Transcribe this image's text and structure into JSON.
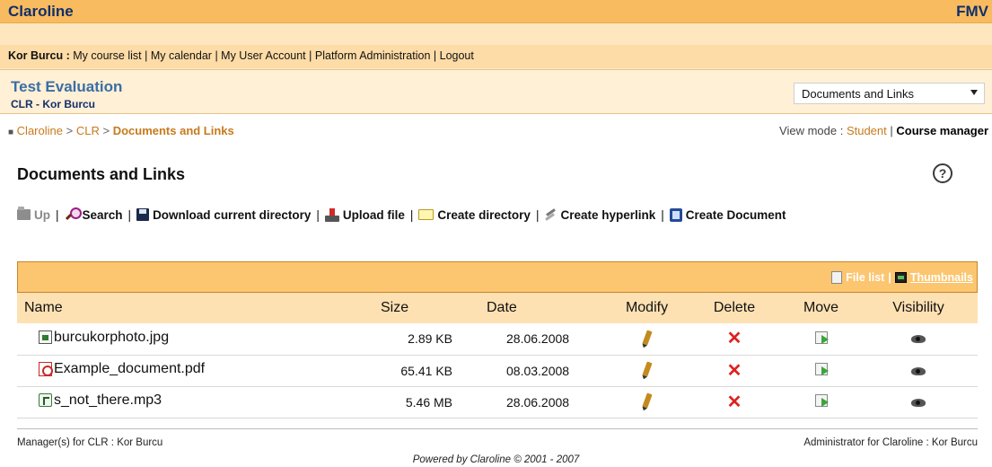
{
  "banner": {
    "platform": "Claroline",
    "institution": "FMV"
  },
  "userbar": {
    "user_name": "Kor Burcu :",
    "links": [
      "My course list",
      "My calendar",
      "My User Account",
      "Platform Administration",
      "Logout"
    ],
    "separator": "|"
  },
  "course": {
    "title": "Test Evaluation",
    "subtitle": "CLR - Kor Burcu"
  },
  "tool_select": {
    "value": "Documents and Links"
  },
  "breadcrumb": {
    "items": [
      "Claroline",
      "CLR"
    ],
    "current": "Documents and Links",
    "separator": ">"
  },
  "view_mode": {
    "label": "View mode :",
    "student": "Student",
    "manager": "Course manager"
  },
  "page": {
    "title": "Documents and Links",
    "help_glyph": "?"
  },
  "commands": {
    "up": "Up",
    "search": "Search",
    "download": "Download current directory",
    "upload": "Upload file",
    "create_dir": "Create directory",
    "create_link": "Create hyperlink",
    "create_doc": "Create Document",
    "separator": "|"
  },
  "view_toggle": {
    "file_list": "File list",
    "thumbnails": "Thumbnails",
    "separator": "|"
  },
  "table": {
    "headers": {
      "name": "Name",
      "size": "Size",
      "date": "Date",
      "modify": "Modify",
      "delete": "Delete",
      "move": "Move",
      "visibility": "Visibility"
    },
    "rows": [
      {
        "name": "burcukorphoto.jpg",
        "size": "2.89 KB",
        "date": "28.06.2008",
        "icon": "image-file-icon"
      },
      {
        "name": "Example_document.pdf",
        "size": "65.41 KB",
        "date": "08.03.2008",
        "icon": "pdf-file-icon"
      },
      {
        "name": "s_not_there.mp3",
        "size": "5.46 MB",
        "date": "28.06.2008",
        "icon": "audio-file-icon"
      }
    ]
  },
  "footer": {
    "managers": "Manager(s) for CLR : Kor Burcu",
    "administrator": "Administrator for Claroline : Kor Burcu",
    "powered": "Powered by Claroline © 2001 - 2007"
  },
  "colors": {
    "banner": "#f9bb5f",
    "accent_link": "#c77a1b",
    "course_title": "#3a6ea5",
    "delete_red": "#e02020"
  }
}
